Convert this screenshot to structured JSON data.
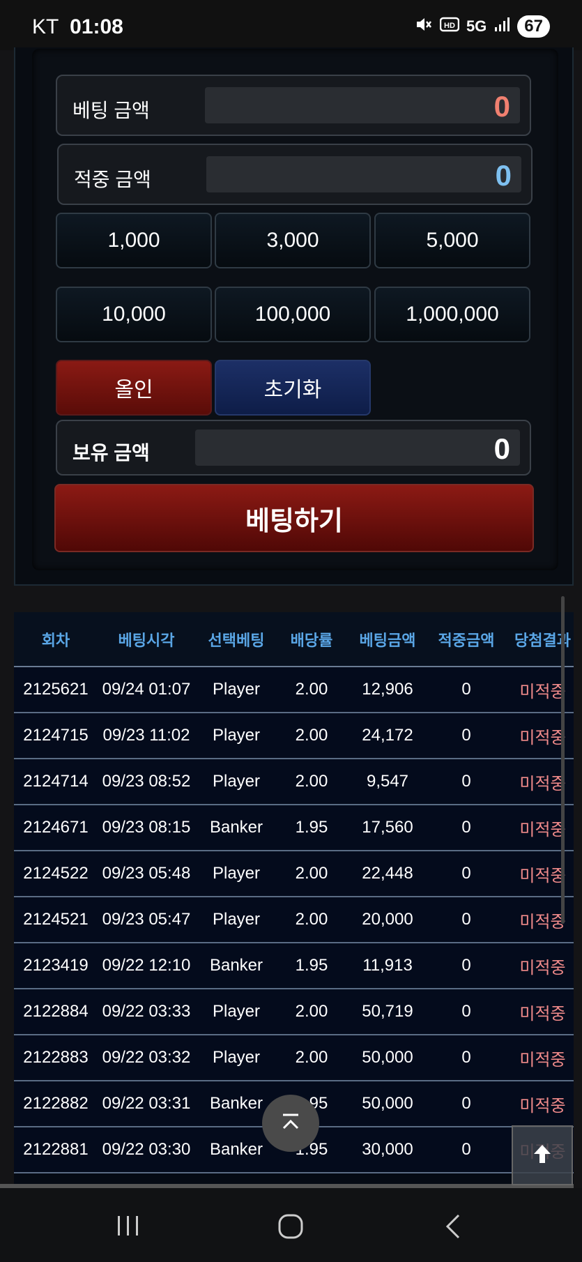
{
  "status_bar": {
    "carrier": "KT",
    "time": "01:08",
    "icons": [
      "mute-icon",
      "hd-icon",
      "5g-icon",
      "signal-icon"
    ],
    "network": "5G",
    "battery": "67"
  },
  "bet_panel": {
    "bet_amount_label": "베팅 금액",
    "bet_amount_value": "0",
    "win_amount_label": "적중 금액",
    "win_amount_value": "0",
    "chips": [
      "1,000",
      "3,000",
      "5,000",
      "10,000",
      "100,000",
      "1,000,000"
    ],
    "all_in_label": "올인",
    "reset_label": "초기화",
    "balance_label": "보유 금액",
    "balance_value": "0",
    "bet_button_label": "베팅하기"
  },
  "history": {
    "columns": [
      "회차",
      "베팅시각",
      "선택베팅",
      "배당률",
      "베팅금액",
      "적중금액",
      "당첨결과"
    ],
    "rows": [
      [
        "2125621",
        "09/24 01:07",
        "Player",
        "2.00",
        "12,906",
        "0",
        "미적중"
      ],
      [
        "2124715",
        "09/23 11:02",
        "Player",
        "2.00",
        "24,172",
        "0",
        "미적중"
      ],
      [
        "2124714",
        "09/23 08:52",
        "Player",
        "2.00",
        "9,547",
        "0",
        "미적중"
      ],
      [
        "2124671",
        "09/23 08:15",
        "Banker",
        "1.95",
        "17,560",
        "0",
        "미적중"
      ],
      [
        "2124522",
        "09/23 05:48",
        "Player",
        "2.00",
        "22,448",
        "0",
        "미적중"
      ],
      [
        "2124521",
        "09/23 05:47",
        "Player",
        "2.00",
        "20,000",
        "0",
        "미적중"
      ],
      [
        "2123419",
        "09/22 12:10",
        "Banker",
        "1.95",
        "11,913",
        "0",
        "미적중"
      ],
      [
        "2122884",
        "09/22 03:33",
        "Player",
        "2.00",
        "50,719",
        "0",
        "미적중"
      ],
      [
        "2122883",
        "09/22 03:32",
        "Player",
        "2.00",
        "50,000",
        "0",
        "미적중"
      ],
      [
        "2122882",
        "09/22 03:31",
        "Banker",
        "1.95",
        "50,000",
        "0",
        "미적중"
      ],
      [
        "2122881",
        "09/22 03:30",
        "Banker",
        "1.95",
        "30,000",
        "0",
        "미적중"
      ]
    ]
  },
  "colors": {
    "bet_amount": "#f08070",
    "win_amount": "#7ec0f0",
    "header_text": "#5aa6e6",
    "result_text": "#f08a8a"
  }
}
